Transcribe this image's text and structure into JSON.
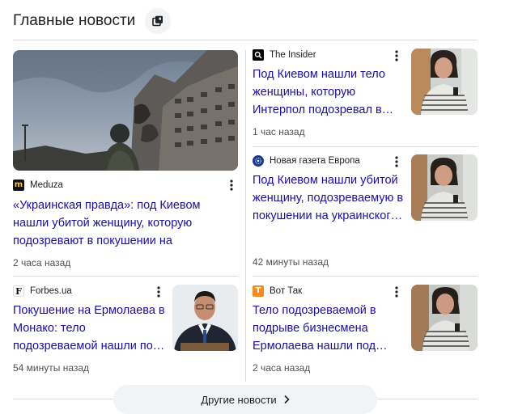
{
  "header": {
    "title": "Главные новости"
  },
  "featured": {
    "source": "Meduza",
    "headline": "«Украинская правда»: под Киевом нашли убитой женщину, которую подозревают в покушении на украинского бизнесмен…",
    "time": "2 часа назад"
  },
  "articles": [
    {
      "source": "The Insider",
      "headline": "Под Киевом нашли тело женщины, которую Интерпол подозревал в…",
      "time": "1 час назад"
    },
    {
      "source": "Новая газета Европа",
      "headline": "Под Киевом нашли убитой женщину, подозреваемую в покушении на украинског…",
      "time": "42 минуты назад"
    },
    {
      "source": "Forbes.ua",
      "headline": "Покушение на Ермолаева в Монако: тело подозреваемой нашли по…",
      "time": "54 минуты назад"
    },
    {
      "source": "Вот Так",
      "headline": "Тело подозреваемой в подрыве бизнесмена Ермолаева нашли под…",
      "time": "2 часа назад"
    }
  ],
  "more": {
    "label": "Другие новости"
  },
  "colors": {
    "link": "#1a0dab",
    "divider": "#dadce0",
    "pill": "#f1f3f4"
  }
}
